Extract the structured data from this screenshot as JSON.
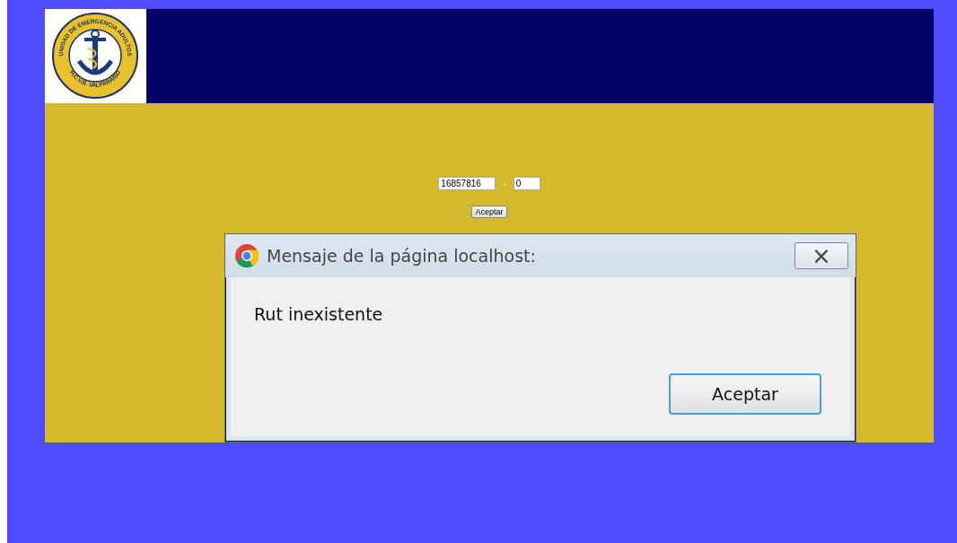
{
  "header": {
    "logo": {
      "top_text": "UNIDAD DE EMERGENCIA ADULTOS",
      "bottom_text": "H.C.V.B.  VALPARAISO"
    }
  },
  "form": {
    "rut": {
      "value": "16857816"
    },
    "separator": "-",
    "dv": {
      "value": "0"
    },
    "submit": "Aceptar"
  },
  "dialog": {
    "title": "Mensaje de la página localhost:",
    "close": "×",
    "message": "Rut inexistente",
    "button": "Aceptar"
  }
}
